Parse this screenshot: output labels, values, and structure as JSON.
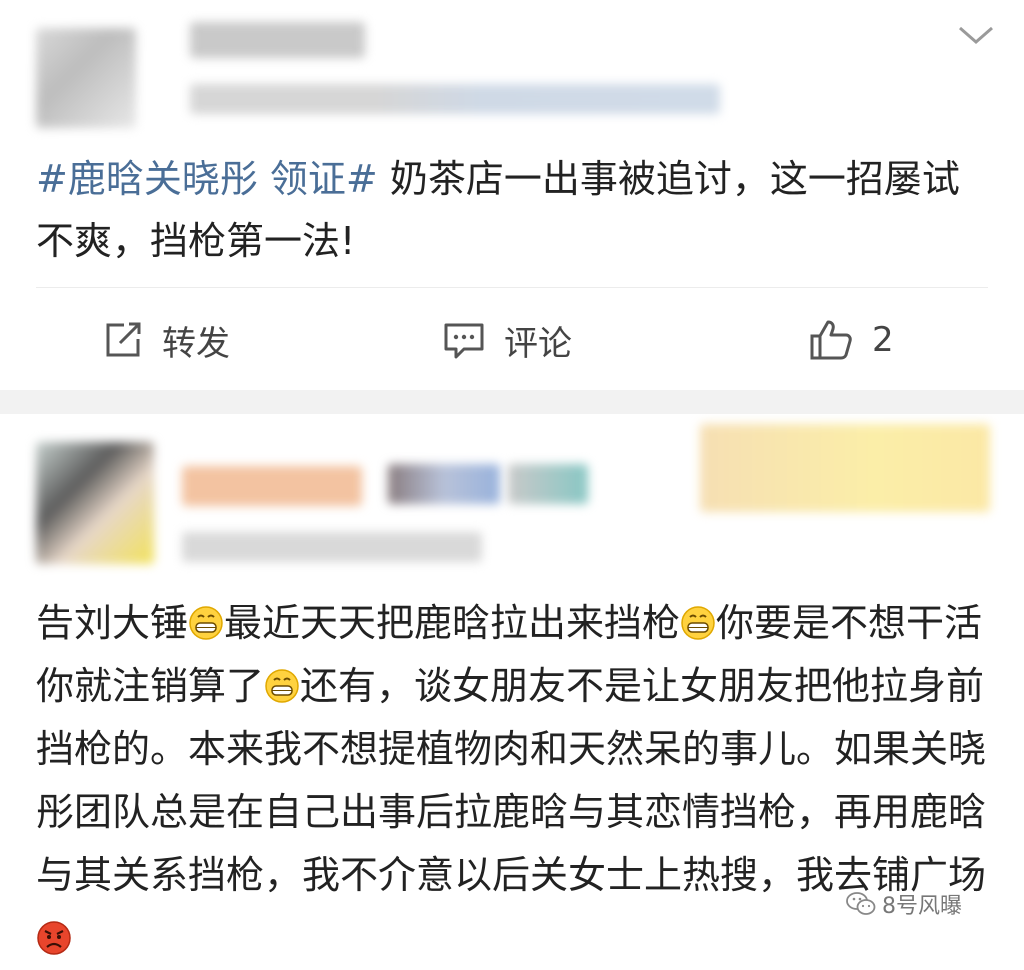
{
  "post1": {
    "hashtag": "#鹿晗关晓彤 领证#",
    "text": " 奶茶店一出事被追讨，这一招屡试不爽，挡枪第一法!",
    "actions": {
      "repost_label": "转发",
      "comment_label": "评论",
      "like_count": "2"
    }
  },
  "post2": {
    "segments": [
      "告刘大锤",
      "最近天天把鹿晗拉出来挡枪",
      "你要是不想干活你就注销算了",
      "还有，谈女朋友不是让女朋友把他拉身前挡枪的。本来我不想提植物肉和天然呆的事儿。如果关晓彤团队总是在自己出事后拉鹿晗与其恋情挡枪，再用鹿晗与其关系挡枪，我不介意以后关女士上热搜，我去铺广场"
    ]
  },
  "watermark": {
    "text": "8号风曝"
  },
  "colors": {
    "hashtag": "#4a6e97",
    "text": "#222222",
    "divider_band": "#f2f2f2"
  }
}
